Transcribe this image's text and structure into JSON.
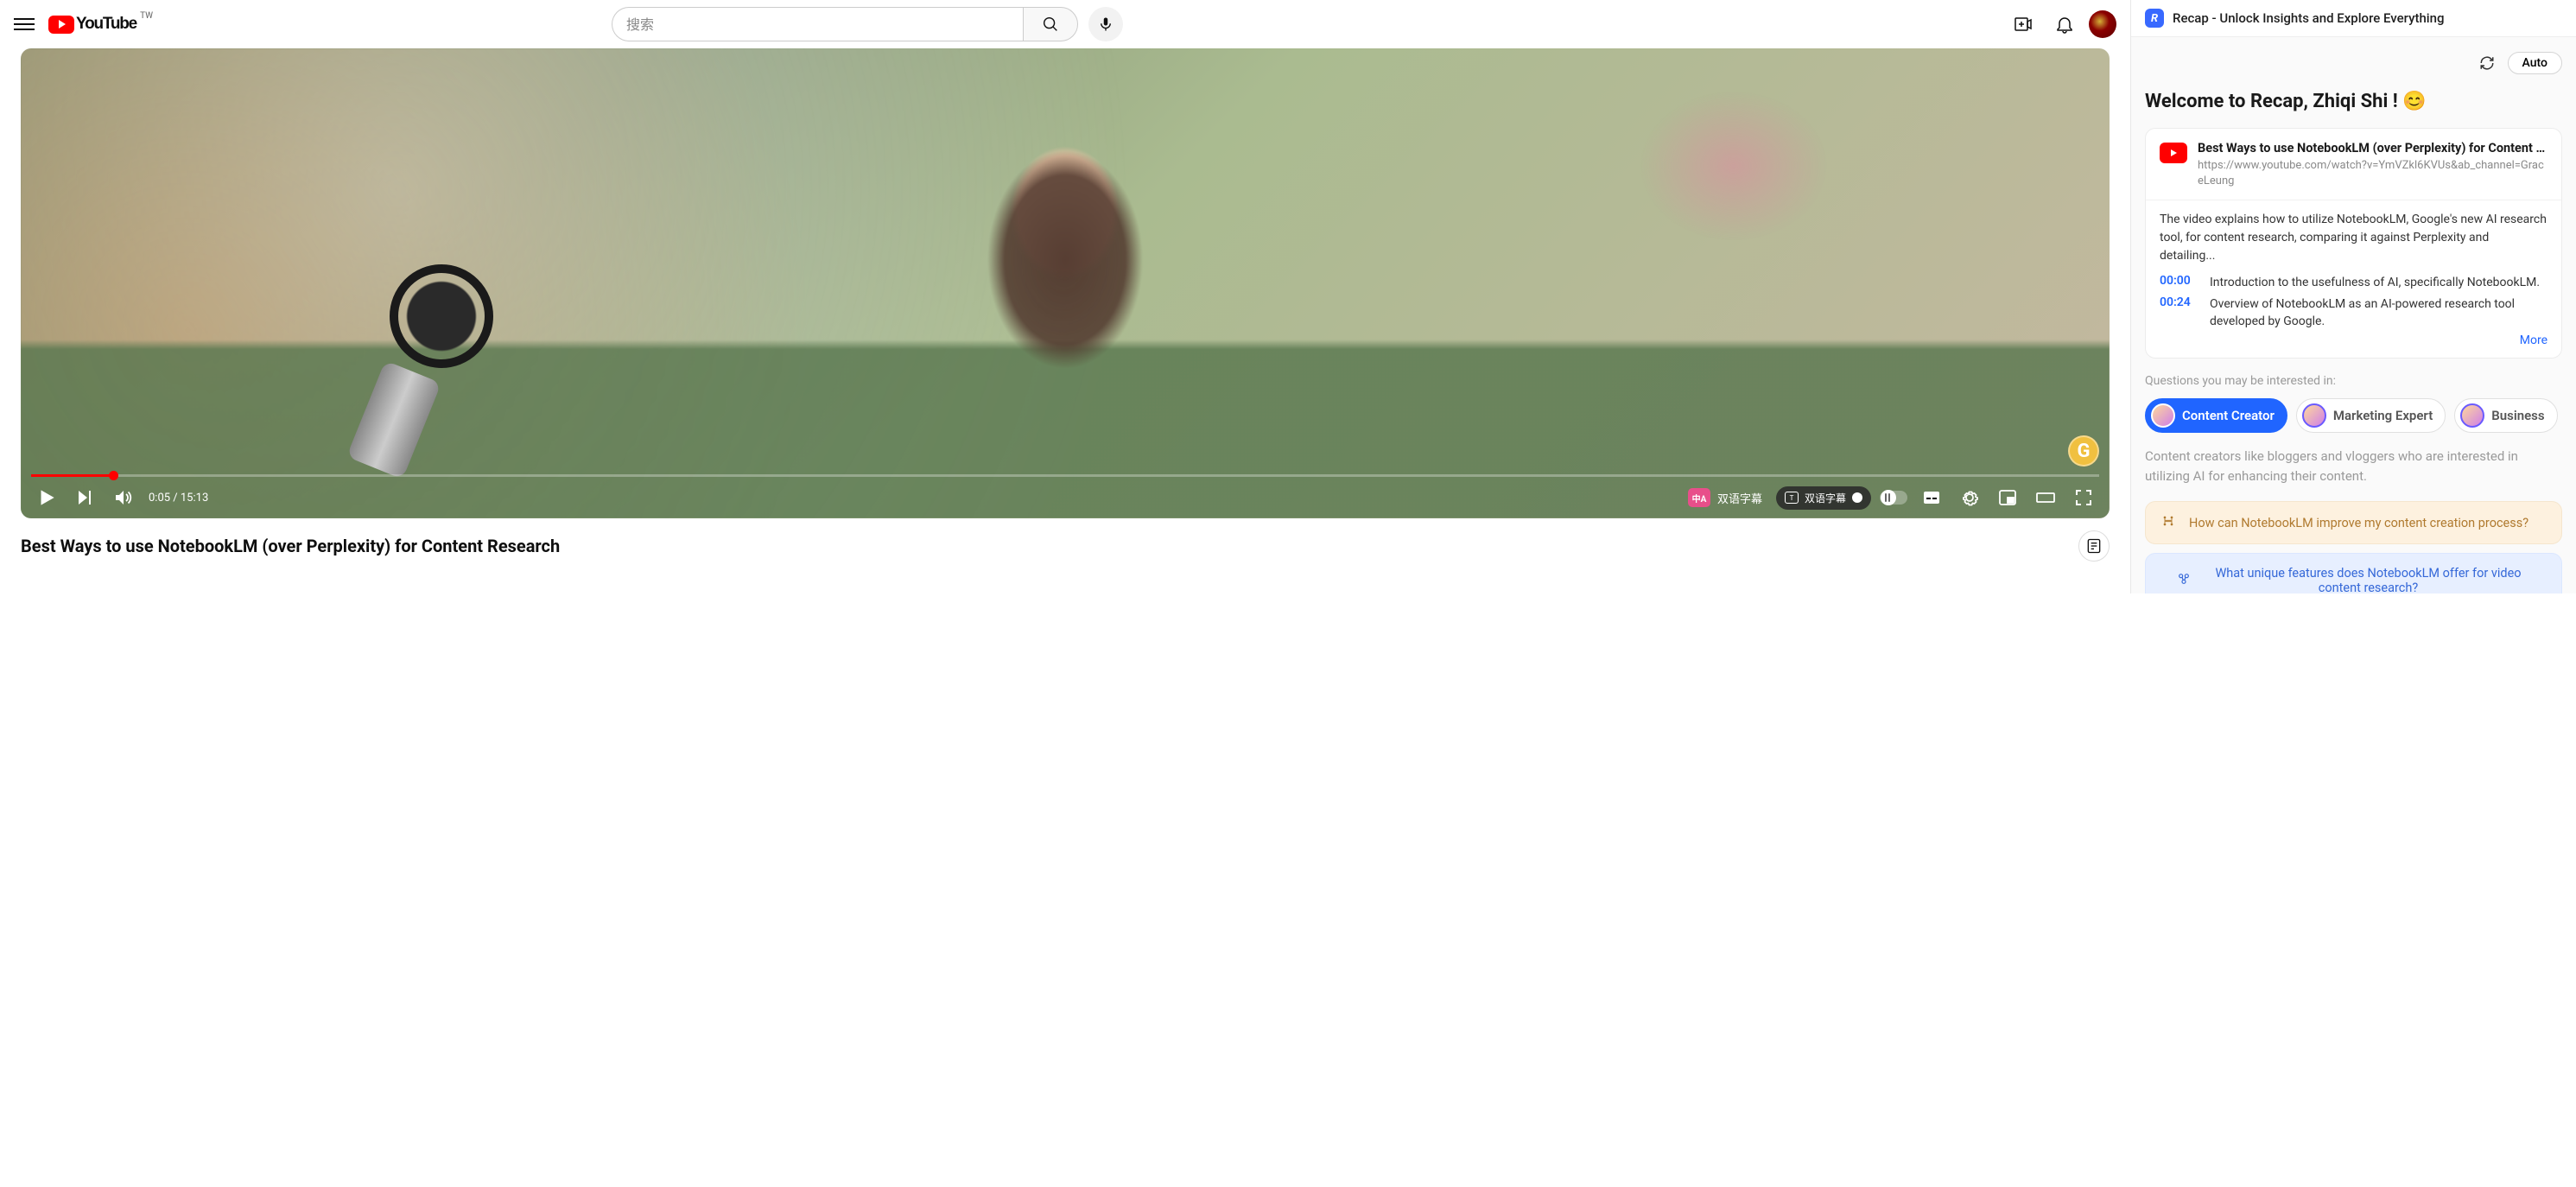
{
  "youtube": {
    "region": "TW",
    "brand": "YouTube",
    "search_placeholder": "搜索",
    "player": {
      "time_display": "0:05 / 15:13",
      "subtitle_label": "双语字幕",
      "subtitle_pill": "双语字幕",
      "subtitle_badge": "中A",
      "watermark": "G"
    },
    "video_title": "Best Ways to use NotebookLM (over Perplexity) for Content Research"
  },
  "recap": {
    "header_title": "Recap - Unlock Insights and Explore Everything",
    "auto_label": "Auto",
    "welcome": "Welcome to Recap, Zhiqi Shi ! 😊",
    "card": {
      "title": "Best Ways to use NotebookLM (over Perplexity) for Content Rese...",
      "url": "https://www.youtube.com/watch?v=YmVZkl6KVUs&ab_channel=GraceLeung",
      "summary": "The video explains how to utilize NotebookLM, Google's new AI research tool, for content research, comparing it against Perplexity and detailing...",
      "timestamps": [
        {
          "time": "00:00",
          "text": "Introduction to the usefulness of AI, specifically NotebookLM."
        },
        {
          "time": "00:24",
          "text": "Overview of NotebookLM as an AI-powered research tool developed by Google."
        }
      ],
      "more": "More"
    },
    "questions_label": "Questions you may be interested in:",
    "personas": [
      {
        "label": "Content Creator",
        "active": true
      },
      {
        "label": "Marketing Expert",
        "active": false
      },
      {
        "label": "Business",
        "active": false
      }
    ],
    "persona_desc": "Content creators like bloggers and vloggers who are interested in utilizing AI for enhancing their content.",
    "questions": [
      {
        "style": "orange",
        "text": "How can NotebookLM improve my content creation process?"
      },
      {
        "style": "blue",
        "text": "What unique features does NotebookLM offer for video content research?"
      }
    ]
  }
}
